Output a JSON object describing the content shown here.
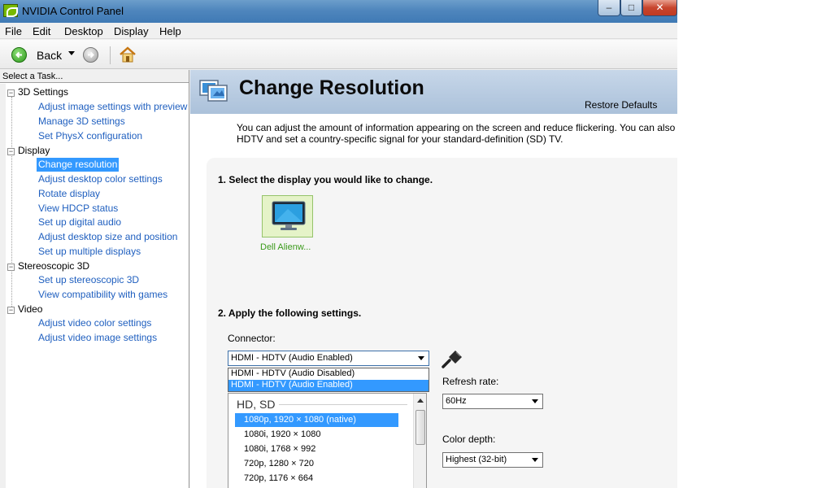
{
  "window": {
    "title": "NVIDIA Control Panel"
  },
  "titlebar_buttons": {
    "minimize": "–",
    "maximize": "□",
    "close": "✕"
  },
  "menu": [
    "File",
    "Edit",
    "Desktop",
    "Display",
    "Help"
  ],
  "toolbar": {
    "back_label": "Back",
    "icons": [
      "back-arrow-icon",
      "forward-arrow-icon",
      "home-icon"
    ]
  },
  "sidebar": {
    "header": "Select a Task...",
    "categories": [
      {
        "label": "3D Settings",
        "toggle": "−",
        "items": [
          "Adjust image settings with preview",
          "Manage 3D settings",
          "Set PhysX configuration"
        ]
      },
      {
        "label": "Display",
        "toggle": "−",
        "items": [
          "Change resolution",
          "Adjust desktop color settings",
          "Rotate display",
          "View HDCP status",
          "Set up digital audio",
          "Adjust desktop size and position",
          "Set up multiple displays"
        ]
      },
      {
        "label": "Stereoscopic 3D",
        "toggle": "−",
        "items": [
          "Set up stereoscopic 3D",
          "View compatibility with games"
        ]
      },
      {
        "label": "Video",
        "toggle": "−",
        "items": [
          "Adjust video color settings",
          "Adjust video image settings"
        ]
      }
    ],
    "selected_item": "Change resolution"
  },
  "page": {
    "title": "Change Resolution",
    "restore_defaults": "Restore Defaults",
    "intro_line1": "You can adjust the amount of information appearing on the screen and reduce flickering. You can also ch",
    "intro_line2": "HDTV and set a country-specific signal for your standard-definition (SD) TV.",
    "step1": "1. Select the display you would like to change.",
    "display_name": "Dell Alienw...",
    "step2": "2. Apply the following settings.",
    "connector": {
      "label": "Connector:",
      "value": "HDMI - HDTV (Audio Enabled)",
      "options": [
        "HDMI - HDTV (Audio Disabled)",
        "HDMI - HDTV (Audio Enabled)"
      ],
      "selected_option": 1
    },
    "resolution": {
      "group": "HD, SD",
      "items": [
        "1080p, 1920 × 1080 (native)",
        "1080i, 1920 × 1080",
        "1080i, 1768 × 992",
        "720p, 1280 × 720",
        "720p, 1176 × 664"
      ],
      "selected_index": 0
    },
    "refresh_rate": {
      "label": "Refresh rate:",
      "value": "60Hz"
    },
    "color_depth": {
      "label": "Color depth:",
      "value": "Highest (32-bit)"
    }
  },
  "colors": {
    "selection": "#3399ff",
    "link": "#1f5fbf",
    "banner": "#b5c9e0",
    "titlebar": "#4f86bd"
  }
}
